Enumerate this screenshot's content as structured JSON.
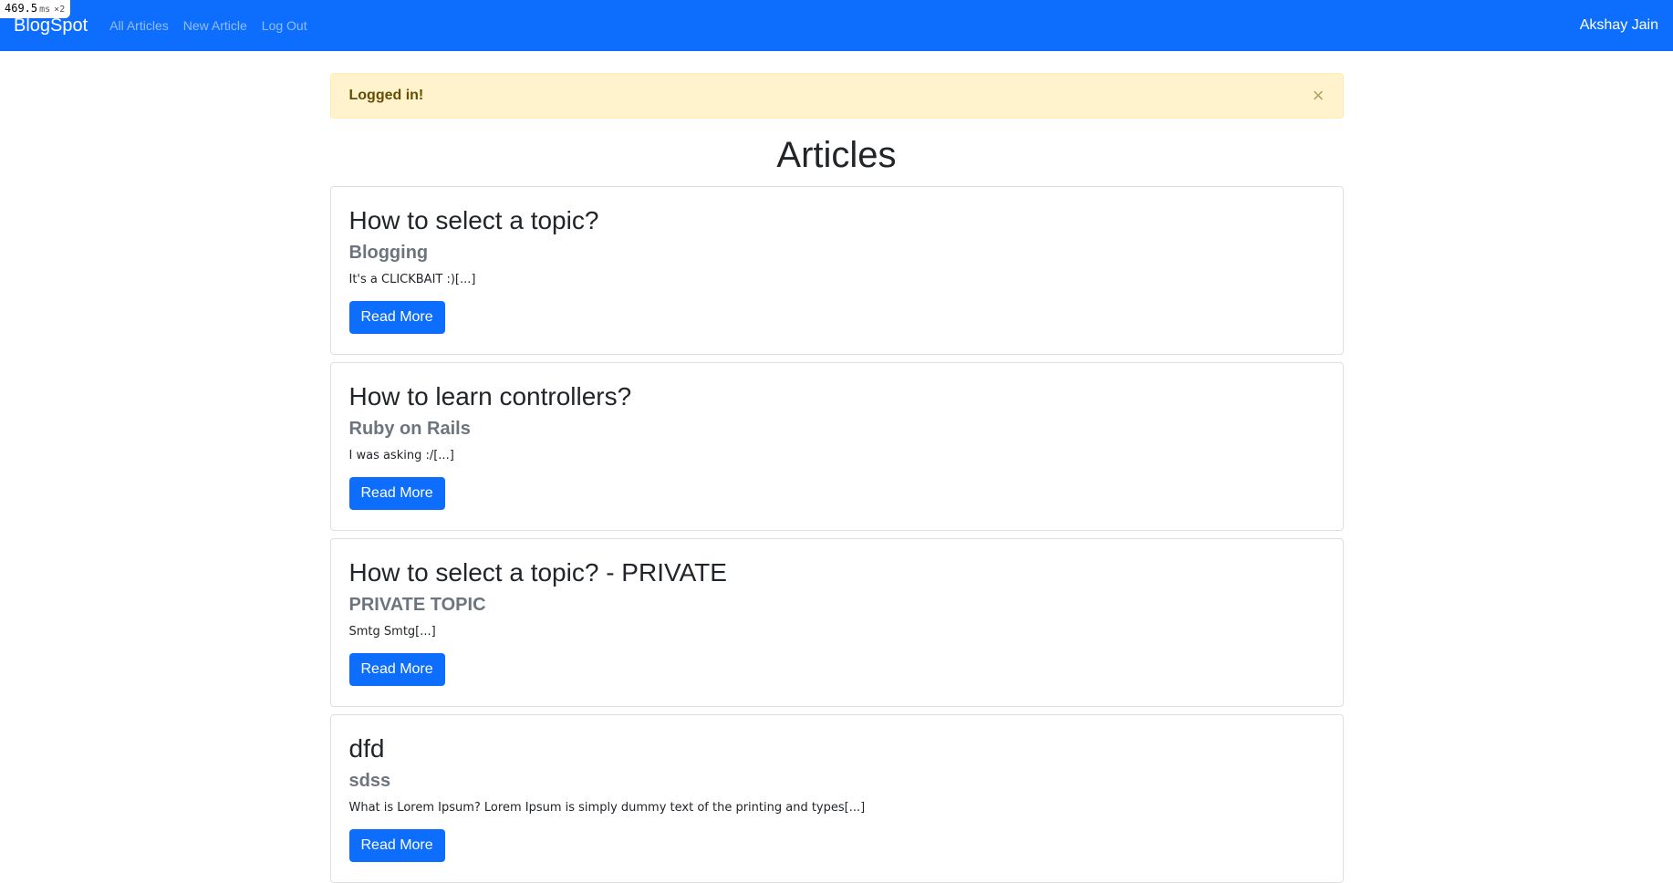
{
  "perf": {
    "value": "469.5",
    "unit": "ms",
    "mult": "×2"
  },
  "navbar": {
    "brand": "BlogSpot",
    "links": [
      "All Articles",
      "New Article",
      "Log Out"
    ],
    "user": "Akshay Jain"
  },
  "alert": {
    "message": "Logged in!",
    "close": "×"
  },
  "page": {
    "title": "Articles"
  },
  "articles": [
    {
      "title": "How to select a topic?",
      "topic": "Blogging",
      "excerpt": "It's a CLICKBAIT :)[...]",
      "button": "Read More"
    },
    {
      "title": "How to learn controllers?",
      "topic": "Ruby on Rails",
      "excerpt": "I was asking :/[...]",
      "button": "Read More"
    },
    {
      "title": "How to select a topic? - PRIVATE",
      "topic": "PRIVATE TOPIC",
      "excerpt": "Smtg Smtg[...]",
      "button": "Read More"
    },
    {
      "title": "dfd",
      "topic": "sdss",
      "excerpt": "What is Lorem Ipsum? Lorem Ipsum is simply dummy text of the printing and types[...]",
      "button": "Read More"
    }
  ],
  "colors": {
    "primary": "#0d6efd",
    "alert_bg": "#fff3cd",
    "alert_text": "#664d03"
  }
}
